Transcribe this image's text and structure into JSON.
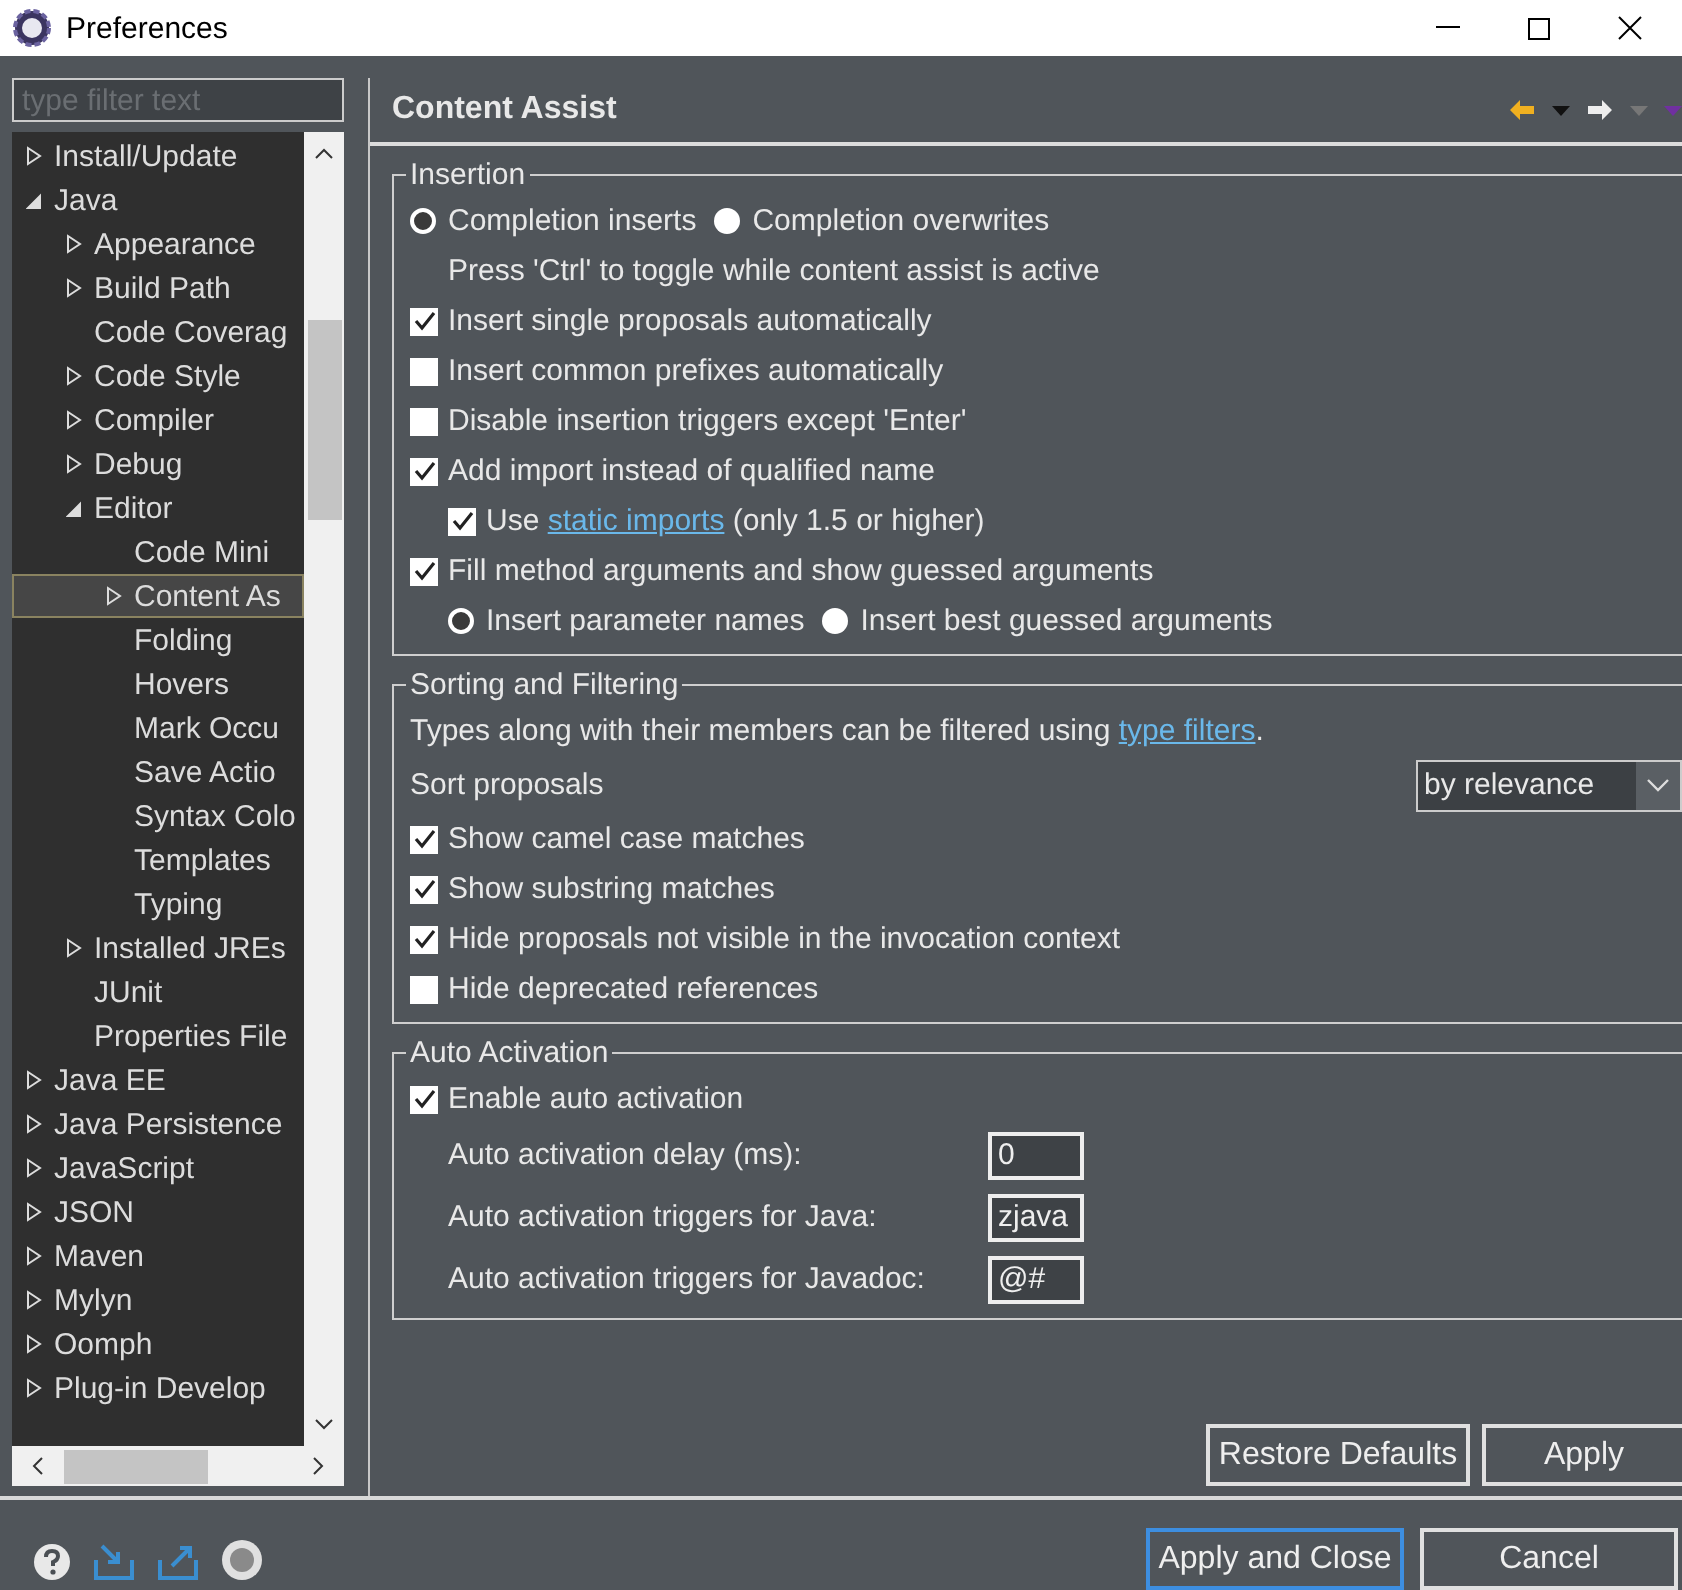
{
  "window": {
    "title": "Preferences"
  },
  "filter": {
    "placeholder": "type filter text"
  },
  "tree": [
    {
      "label": "Install/Update",
      "kind": "folder",
      "expanded": false,
      "selected": false
    },
    {
      "label": "Java",
      "kind": "folder",
      "expanded": true,
      "selected": false,
      "children": [
        {
          "label": "Appearance",
          "kind": "folder",
          "expanded": false,
          "selected": false
        },
        {
          "label": "Build Path",
          "kind": "folder",
          "expanded": false,
          "selected": false
        },
        {
          "label": "Code Coverag",
          "kind": "leaf",
          "selected": false
        },
        {
          "label": "Code Style",
          "kind": "folder",
          "expanded": false,
          "selected": false
        },
        {
          "label": "Compiler",
          "kind": "folder",
          "expanded": false,
          "selected": false
        },
        {
          "label": "Debug",
          "kind": "folder",
          "expanded": false,
          "selected": false
        },
        {
          "label": "Editor",
          "kind": "folder",
          "expanded": true,
          "selected": false,
          "children": [
            {
              "label": "Code Mini",
              "kind": "leaf",
              "selected": false
            },
            {
              "label": "Content As",
              "kind": "folder",
              "expanded": false,
              "selected": true
            },
            {
              "label": "Folding",
              "kind": "leaf",
              "selected": false
            },
            {
              "label": "Hovers",
              "kind": "leaf",
              "selected": false
            },
            {
              "label": "Mark Occu",
              "kind": "leaf",
              "selected": false
            },
            {
              "label": "Save Actio",
              "kind": "leaf",
              "selected": false
            },
            {
              "label": "Syntax Colo",
              "kind": "leaf",
              "selected": false
            },
            {
              "label": "Templates",
              "kind": "leaf",
              "selected": false
            },
            {
              "label": "Typing",
              "kind": "leaf",
              "selected": false
            }
          ]
        },
        {
          "label": "Installed JREs",
          "kind": "folder",
          "expanded": false,
          "selected": false
        },
        {
          "label": "JUnit",
          "kind": "leaf",
          "selected": false
        },
        {
          "label": "Properties File",
          "kind": "leaf",
          "selected": false
        }
      ]
    },
    {
      "label": "Java EE",
      "kind": "folder",
      "expanded": false,
      "selected": false
    },
    {
      "label": "Java Persistence",
      "kind": "folder",
      "expanded": false,
      "selected": false
    },
    {
      "label": "JavaScript",
      "kind": "folder",
      "expanded": false,
      "selected": false
    },
    {
      "label": "JSON",
      "kind": "folder",
      "expanded": false,
      "selected": false
    },
    {
      "label": "Maven",
      "kind": "folder",
      "expanded": false,
      "selected": false
    },
    {
      "label": "Mylyn",
      "kind": "folder",
      "expanded": false,
      "selected": false
    },
    {
      "label": "Oomph",
      "kind": "folder",
      "expanded": false,
      "selected": false
    },
    {
      "label": "Plug-in Develop",
      "kind": "folder",
      "expanded": false,
      "selected": false
    }
  ],
  "page": {
    "title": "Content Assist"
  },
  "sections": [
    {
      "title": "Insertion",
      "rows": [
        {
          "kind": "radio_group",
          "options": [
            {
              "label": "Completion inserts",
              "selected": true
            },
            {
              "label": "Completion overwrites",
              "selected": false
            }
          ]
        },
        {
          "kind": "note",
          "text": "Press 'Ctrl' to toggle while content assist is active"
        },
        {
          "kind": "checkbox",
          "label": "Insert single proposals automatically",
          "checked": true
        },
        {
          "kind": "checkbox",
          "label": "Insert common prefixes automatically",
          "checked": false
        },
        {
          "kind": "checkbox",
          "label": "Disable insertion triggers except 'Enter'",
          "checked": false
        },
        {
          "kind": "checkbox",
          "label": "Add import instead of qualified name",
          "checked": true,
          "children": [
            {
              "kind": "checkbox",
              "checked": true,
              "label_parts": [
                {
                  "text": "Use "
                },
                {
                  "text": "static imports",
                  "link": true
                },
                {
                  "text": " (only 1.5 or higher)"
                }
              ]
            }
          ]
        },
        {
          "kind": "checkbox",
          "label": "Fill method arguments and show guessed arguments",
          "checked": true,
          "children": [
            {
              "kind": "radio_group",
              "options": [
                {
                  "label": "Insert parameter names",
                  "selected": true
                },
                {
                  "label": "Insert best guessed arguments",
                  "selected": false
                }
              ]
            }
          ]
        }
      ]
    },
    {
      "title": "Sorting and Filtering",
      "rows": [
        {
          "kind": "text",
          "parts": [
            {
              "text": "Types along with their members can be filtered using "
            },
            {
              "text": "type filters",
              "link": true
            },
            {
              "text": "."
            }
          ]
        },
        {
          "kind": "select",
          "label": "Sort proposals",
          "value": "by relevance"
        },
        {
          "kind": "checkbox",
          "label": "Show camel case matches",
          "checked": true
        },
        {
          "kind": "checkbox",
          "label": "Show substring matches",
          "checked": true
        },
        {
          "kind": "checkbox",
          "label": "Hide proposals not visible in the invocation context",
          "checked": true
        },
        {
          "kind": "checkbox",
          "label": "Hide deprecated references",
          "checked": false
        }
      ]
    },
    {
      "title": "Auto Activation",
      "rows": [
        {
          "kind": "checkbox",
          "label": "Enable auto activation",
          "checked": true
        },
        {
          "kind": "field",
          "label": "Auto activation delay (ms):",
          "value": "0"
        },
        {
          "kind": "field",
          "label": "Auto activation triggers for Java:",
          "value": "zjava"
        },
        {
          "kind": "field",
          "label": "Auto activation triggers for Javadoc:",
          "value": "@#"
        }
      ]
    }
  ],
  "page_buttons": [
    "Restore Defaults",
    "Apply"
  ],
  "dialog_buttons": [
    {
      "label": "Apply and Close",
      "default": true
    },
    {
      "label": "Cancel",
      "default": false
    }
  ]
}
